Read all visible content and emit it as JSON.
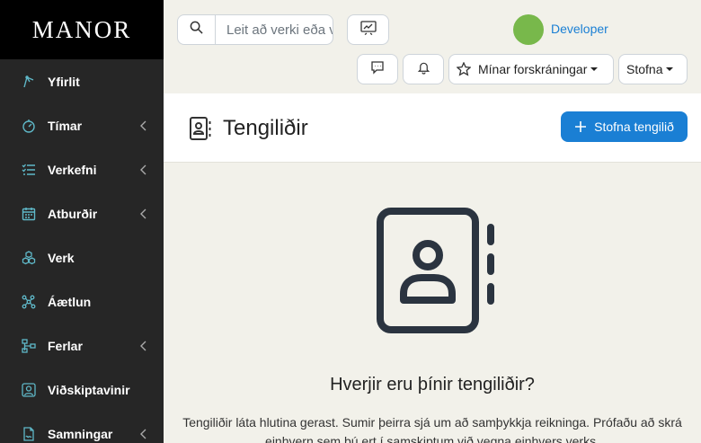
{
  "brand": "MANOR",
  "sidebar": {
    "items": [
      {
        "label": "Yfirlit",
        "icon": "gauge-icon"
      },
      {
        "label": "Tímar",
        "icon": "stopwatch-icon"
      },
      {
        "label": "Verkefni",
        "icon": "task-list-icon"
      },
      {
        "label": "Atburðir",
        "icon": "calendar-icon"
      },
      {
        "label": "Verk",
        "icon": "boxes-icon"
      },
      {
        "label": "Áætlun",
        "icon": "diagram-icon"
      },
      {
        "label": "Ferlar",
        "icon": "workflow-icon"
      },
      {
        "label": "Viðskiptavinir",
        "icon": "person-square-icon"
      },
      {
        "label": "Samningar",
        "icon": "file-contract-icon"
      }
    ]
  },
  "topbar": {
    "search_placeholder": "Leit að verki eða viðskiptavini",
    "user_name": "Developer",
    "my_registrations_label": "Mínar forskráningar",
    "create_menu_label": "Stofna"
  },
  "header": {
    "title": "Tengiliðir",
    "create_button_label": "Stofna tengilið"
  },
  "empty_state": {
    "title": "Hverjir eru þínir tengiliðir?",
    "text": "Tengiliðir láta hlutina gerast. Sumir þeirra sjá um að samþykkja reikninga. Prófaðu að skrá einhvern sem þú ert í samskiptum við vegna einhvers verks."
  },
  "colors": {
    "accent": "#1a7fd4",
    "sidebar_bg": "#262626",
    "avatar": "#78b84b",
    "icon_teal": "#5fb8c8"
  }
}
